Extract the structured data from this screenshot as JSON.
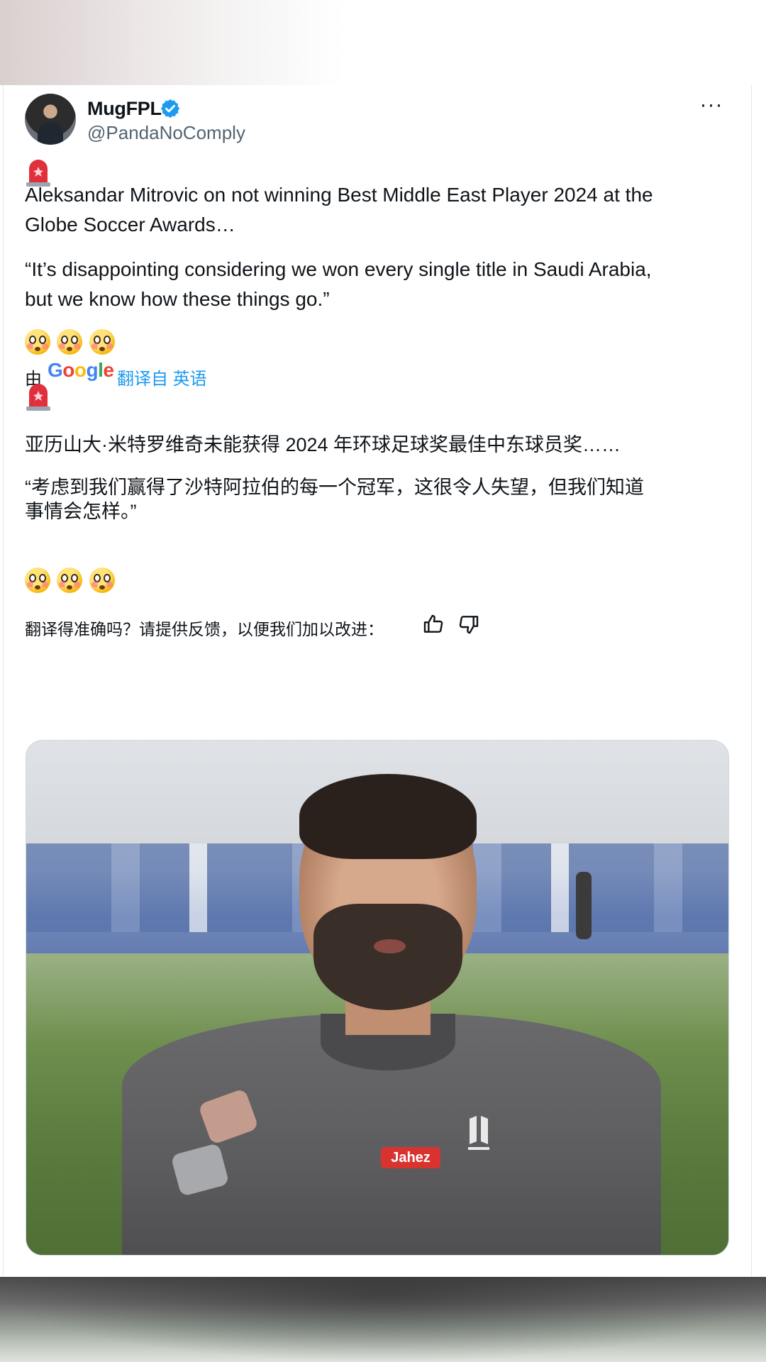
{
  "tweet": {
    "author": {
      "display_name": "MugFPL",
      "handle": "@PandaNoComply",
      "verified": true
    },
    "more_icon": "more-horizontal-icon",
    "original": {
      "lead_emoji": "rotating-light",
      "paragraph1": "Aleksandar Mitrovic on not winning Best Middle East Player 2024 at the\nGlobe Soccer Awards…",
      "paragraph2": "“It’s disappointing considering we won every single title in Saudi Arabia,\nbut we know how these things go.”",
      "trailing_emoji": [
        "flushed-face",
        "flushed-face",
        "flushed-face"
      ]
    },
    "translation": {
      "by_label": "由",
      "provider": "Google",
      "link_label": "翻译自 英语",
      "paragraph1": "亚历山大·米特罗维奇未能获得 2024 年环球足球奖最佳中东球员奖……",
      "paragraph2": "“考虑到我们赢得了沙特阿拉伯的每一个冠军，这很令人失望，但我们知道\n事情会怎样。”",
      "feedback_prompt": "翻译得准确吗？请提供反馈，以便我们加以改进：",
      "thumb_up_icon": "thumbs-up-icon",
      "thumb_down_icon": "thumbs-down-icon"
    },
    "media": {
      "jersey_sponsor": "Jahez"
    }
  },
  "colors": {
    "link": "#1d9bf0",
    "verified": "#1d9bf0",
    "text": "#0f1419",
    "secondary": "#536471"
  }
}
